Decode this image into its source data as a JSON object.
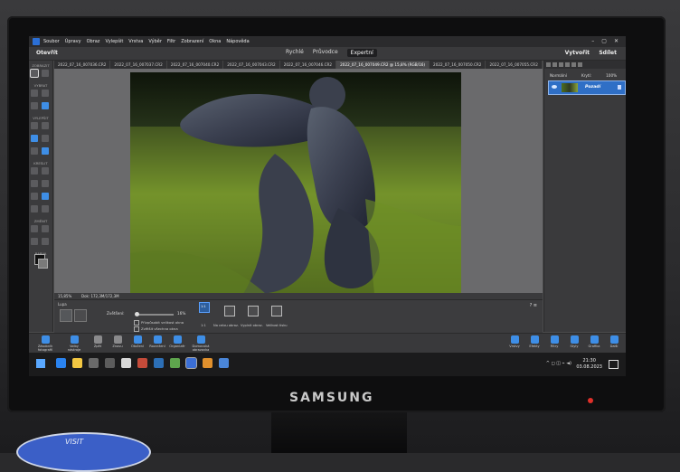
{
  "monitor": {
    "brand": "SAMSUNG"
  },
  "desk_item": {
    "text": "VISIT"
  },
  "app": {
    "menu": [
      "Soubor",
      "Úpravy",
      "Obraz",
      "Vylepšit",
      "Vrstva",
      "Výběr",
      "Filtr",
      "Zobrazení",
      "Okna",
      "Nápověda"
    ],
    "open_label": "Otevřít",
    "modes": [
      "Rychlé",
      "Průvodce",
      "Expertní"
    ],
    "active_mode": "Expertní",
    "create_label": "Vytvořit",
    "share_label": "Sdílet",
    "tabs": [
      "2022_07_16_007036.CR2",
      "2022_07_16_007037.CR2",
      "2022_07_16_007040.CR2",
      "2022_07_16_007043.CR2",
      "2022_07_16_007046.CR2",
      "2022_07_16_007049.CR2 @ 15,8% (RGB/16)",
      "2022_07_16_007050.CR2",
      "2022_07_16_007055.CR2"
    ],
    "active_tab_index": 5,
    "toolbar_groups": [
      "ZOBRAZIT",
      "VYBRAT",
      "VYLEPŠIT",
      "KRESLIT",
      "ZMĚNIT",
      "BARVA"
    ],
    "status": {
      "zoom": "15,85%",
      "size": "Dok: 172,3M/172,3M"
    },
    "layers": {
      "blend_mode": "Normální",
      "opacity_label": "Krytí:",
      "opacity_value": "100%",
      "layer_name": "Pozadí"
    },
    "options": {
      "tool_label": "Lupa",
      "zoom_label": "Zvětšení:",
      "zoom_value": "16%",
      "chk1": "Přizpůsobit velikost okna",
      "chk2": "Zvětšit všechna okna",
      "b1_top": "1:1",
      "b1": "1:1",
      "b2": "Na celou obraz.",
      "b3": "Vyplnit obraz.",
      "b4": "Velikost tisku"
    },
    "task_panel": {
      "left": [
        "Zásobník fotografií",
        "Volby nástroje",
        "Zpět",
        "Znovu",
        "Otočení",
        "Rozvržení",
        "Organizér",
        "Domovská obrazovka"
      ],
      "right": [
        "Vrstvy",
        "Efekty",
        "Filtry",
        "Styly",
        "Grafika",
        "Další"
      ]
    },
    "taskbar": {
      "time": "21:30",
      "date": "03.08.2023"
    }
  }
}
